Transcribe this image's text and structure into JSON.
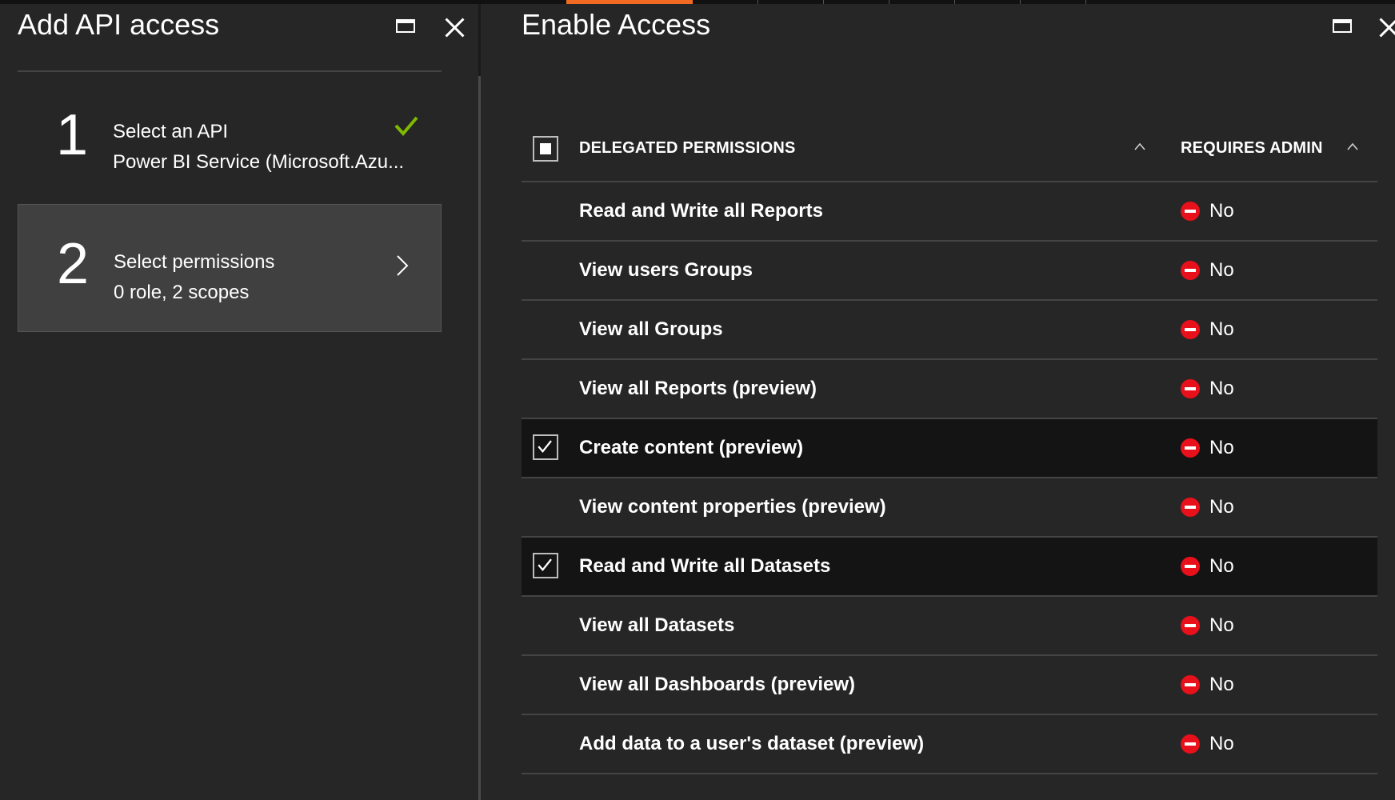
{
  "left_blade": {
    "title": "Add API access",
    "steps": [
      {
        "number": "1",
        "line1": "Select an API",
        "line2": "Power BI Service (Microsoft.Azu...",
        "status": "complete"
      },
      {
        "number": "2",
        "line1": "Select permissions",
        "line2": "0 role, 2 scopes",
        "status": "active"
      }
    ]
  },
  "right_blade": {
    "title": "Enable Access",
    "columns": {
      "permission": "DELEGATED PERMISSIONS",
      "admin": "REQUIRES ADMIN"
    },
    "rows": [
      {
        "label": "Read and Write all Reports",
        "admin": "No",
        "checked": false
      },
      {
        "label": "View users Groups",
        "admin": "No",
        "checked": false
      },
      {
        "label": "View all Groups",
        "admin": "No",
        "checked": false
      },
      {
        "label": "View all Reports (preview)",
        "admin": "No",
        "checked": false
      },
      {
        "label": "Create content (preview)",
        "admin": "No",
        "checked": true
      },
      {
        "label": "View content properties (preview)",
        "admin": "No",
        "checked": false
      },
      {
        "label": "Read and Write all Datasets",
        "admin": "No",
        "checked": true
      },
      {
        "label": "View all Datasets",
        "admin": "No",
        "checked": false
      },
      {
        "label": "View all Dashboards (preview)",
        "admin": "No",
        "checked": false
      },
      {
        "label": "Add data to a user's dataset (preview)",
        "admin": "No",
        "checked": false
      }
    ]
  },
  "colors": {
    "accent_orange": "#f26a22",
    "check_green": "#7fba00",
    "deny_red": "#e8101b",
    "panel": "#262626",
    "active_step": "#404040"
  }
}
